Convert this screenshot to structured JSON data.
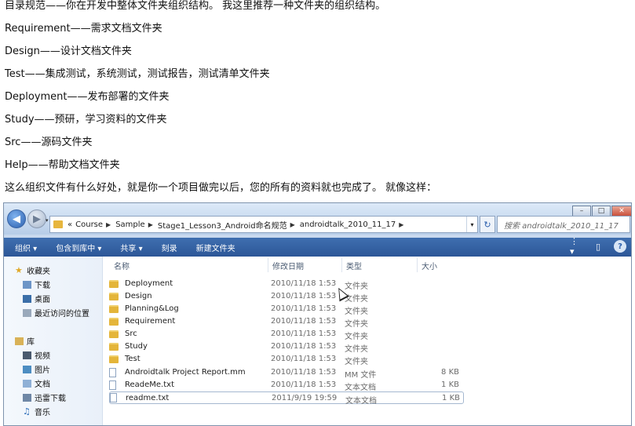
{
  "article": {
    "paragraphs": [
      "目录规范——你在开发中整体文件夹组织结构。 我这里推荐一种文件夹的组织结构。",
      "Requirement——需求文档文件夹",
      "Design——设计文档文件夹",
      "Test——集成测试，系统测试，测试报告，测试清单文件夹",
      "Deployment——发布部署的文件夹",
      "Study——预研，学习资料的文件夹",
      "Src——源码文件夹",
      "Help——帮助文档文件夹",
      "这么组织文件有什么好处，就是你一个项目做完以后，您的所有的资料就也完成了。 就像这样："
    ]
  },
  "explorer": {
    "address": {
      "overflow": "«",
      "segments": [
        "Course",
        "Sample",
        "Stage1_Lesson3_Android命名规范",
        "androidtalk_2010_11_17"
      ]
    },
    "search_placeholder": "搜索 androidtalk_2010_11_17",
    "toolbar": {
      "organize": "组织 ▾",
      "include_library": "包含到库中 ▾",
      "share": "共享 ▾",
      "burn": "刻录",
      "new_folder": "新建文件夹"
    },
    "sidebar": {
      "favorites_label": "收藏夹",
      "favorites": [
        "下载",
        "桌面",
        "最近访问的位置"
      ],
      "libraries_label": "库",
      "libraries": [
        "视频",
        "图片",
        "文档",
        "迅雷下载",
        "音乐"
      ]
    },
    "columns": {
      "name": "名称",
      "date": "修改日期",
      "type": "类型",
      "size": "大小"
    },
    "files": [
      {
        "name": "Deployment",
        "date": "2010/11/18 1:53",
        "type": "文件夹",
        "size": "",
        "kind": "folder"
      },
      {
        "name": "Design",
        "date": "2010/11/18 1:53",
        "type": "文件夹",
        "size": "",
        "kind": "folder"
      },
      {
        "name": "Planning&Log",
        "date": "2010/11/18 1:53",
        "type": "文件夹",
        "size": "",
        "kind": "folder"
      },
      {
        "name": "Requirement",
        "date": "2010/11/18 1:53",
        "type": "文件夹",
        "size": "",
        "kind": "folder"
      },
      {
        "name": "Src",
        "date": "2010/11/18 1:53",
        "type": "文件夹",
        "size": "",
        "kind": "folder"
      },
      {
        "name": "Study",
        "date": "2010/11/18 1:53",
        "type": "文件夹",
        "size": "",
        "kind": "folder"
      },
      {
        "name": "Test",
        "date": "2010/11/18 1:53",
        "type": "文件夹",
        "size": "",
        "kind": "folder"
      },
      {
        "name": "Androidtalk Project Report.mm",
        "date": "2010/11/18 1:53",
        "type": "MM 文件",
        "size": "8 KB",
        "kind": "file"
      },
      {
        "name": "ReadeMe.txt",
        "date": "2010/11/18 1:53",
        "type": "文本文档",
        "size": "1 KB",
        "kind": "file"
      },
      {
        "name": "readme.txt",
        "date": "2011/9/19 19:59",
        "type": "文本文档",
        "size": "1 KB",
        "kind": "file"
      }
    ]
  }
}
